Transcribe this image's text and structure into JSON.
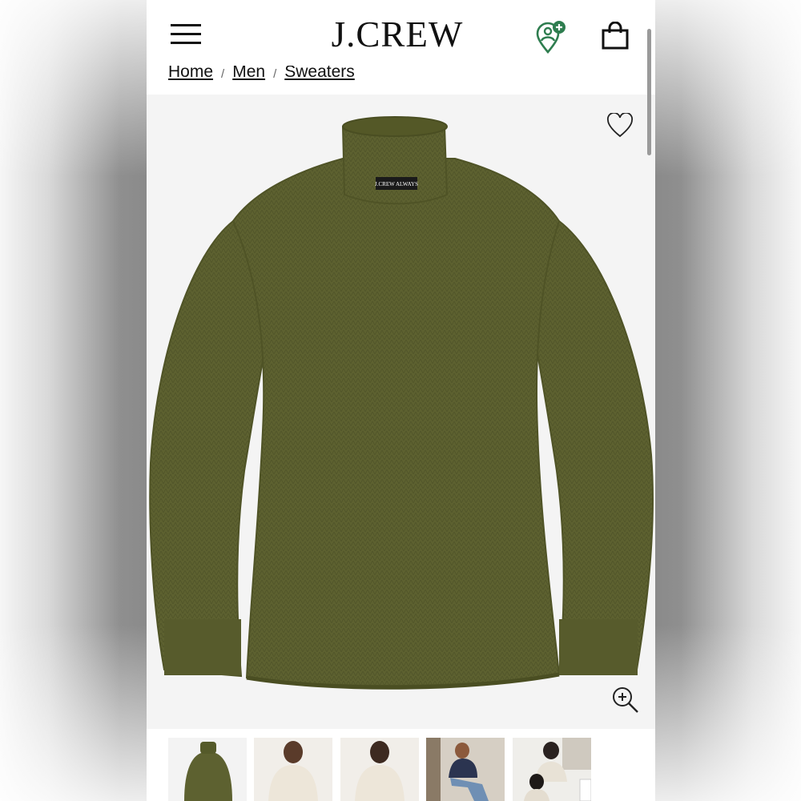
{
  "header": {
    "logo_text": "J.CREW",
    "menu_icon": "hamburger-menu-icon",
    "account_icon": "account-add-icon",
    "bag_icon": "shopping-bag-icon"
  },
  "breadcrumb": {
    "items": [
      {
        "label": "Home"
      },
      {
        "label": "Men"
      },
      {
        "label": "Sweaters"
      }
    ],
    "separator": "/"
  },
  "product": {
    "label_text": "J.CREW ALWAYS",
    "color": "#5d6130",
    "favorite_icon": "heart-icon",
    "zoom_icon": "zoom-in-icon"
  },
  "thumbnails": [
    {
      "icon": "sweater-flat-thumbnail"
    },
    {
      "icon": "model-front-thumbnail"
    },
    {
      "icon": "model-back-thumbnail"
    },
    {
      "icon": "model-seated-thumbnail"
    },
    {
      "icon": "models-lifestyle-thumbnail"
    }
  ],
  "colors": {
    "accent_green": "#2e7d4f",
    "text": "#111111"
  }
}
